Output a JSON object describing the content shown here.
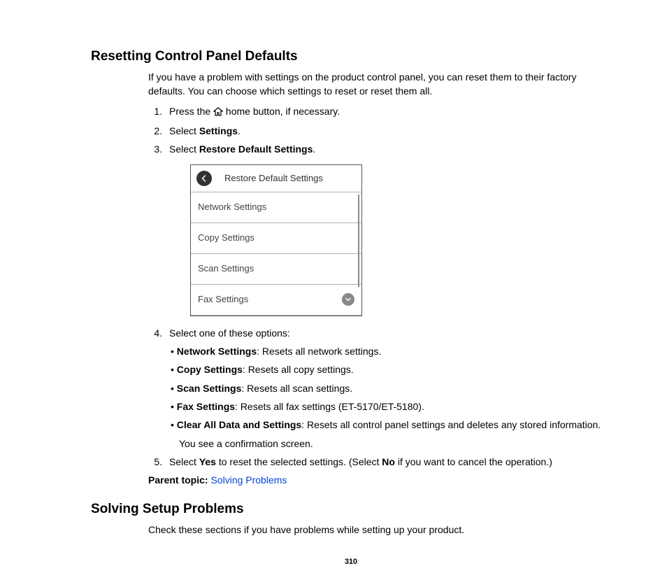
{
  "heading1": "Resetting Control Panel Defaults",
  "intro": "If you have a problem with settings on the product control panel, you can reset them to their factory defaults. You can choose which settings to reset or reset them all.",
  "steps": {
    "s1_pre": "Press the ",
    "s1_post": " home button, if necessary.",
    "s2_pre": "Select ",
    "s2_bold": "Settings",
    "s2_post": ".",
    "s3_pre": "Select ",
    "s3_bold": "Restore Default Settings",
    "s3_post": ".",
    "s4": "Select one of these options:",
    "s4_followup": "You see a confirmation screen.",
    "s5_pre": "Select ",
    "s5_yes": "Yes",
    "s5_mid": " to reset the selected settings. (Select ",
    "s5_no": "No",
    "s5_post": " if you want to cancel the operation.)"
  },
  "options": {
    "o1_bold": "Network Settings",
    "o1_rest": ": Resets all network settings.",
    "o2_bold": "Copy Settings",
    "o2_rest": ": Resets all copy settings.",
    "o3_bold": "Scan Settings",
    "o3_rest": ": Resets all scan settings.",
    "o4_bold": "Fax Settings",
    "o4_rest": ": Resets all fax settings (ET-5170/ET-5180).",
    "o5_bold": "Clear All Data and Settings",
    "o5_rest": ": Resets all control panel settings and deletes any stored information."
  },
  "screenshot": {
    "title": "Restore Default Settings",
    "row1": "Network Settings",
    "row2": "Copy Settings",
    "row3": "Scan Settings",
    "row4": "Fax Settings"
  },
  "parent_label": "Parent topic: ",
  "parent_link": "Solving Problems",
  "heading2": "Solving Setup Problems",
  "intro2": "Check these sections if you have problems while setting up your product.",
  "page_number": "310"
}
